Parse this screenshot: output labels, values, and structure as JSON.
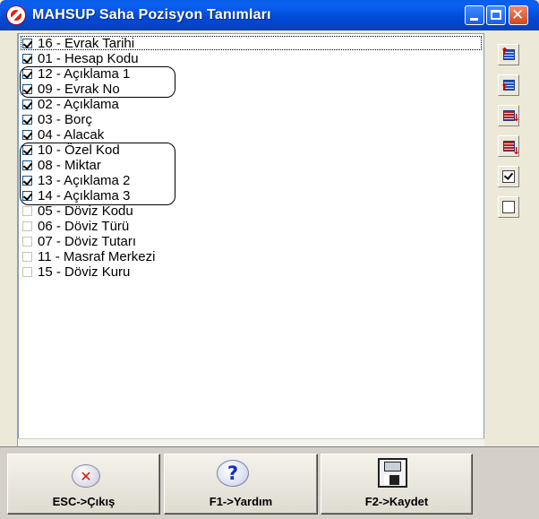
{
  "window": {
    "title": "MAHSUP Saha Pozisyon Tanımları"
  },
  "items": [
    {
      "label": "16 - Evrak Tarihi",
      "checked": true
    },
    {
      "label": "01 - Hesap Kodu",
      "checked": true
    },
    {
      "label": "12 - Açıklama 1",
      "checked": true
    },
    {
      "label": "09 - Evrak No",
      "checked": true
    },
    {
      "label": "02 - Açıklama",
      "checked": true
    },
    {
      "label": "03 - Borç",
      "checked": true
    },
    {
      "label": "04 - Alacak",
      "checked": true
    },
    {
      "label": "10 - Özel Kod",
      "checked": true
    },
    {
      "label": "08 - Miktar",
      "checked": true
    },
    {
      "label": "13 - Açıklama 2",
      "checked": true
    },
    {
      "label": "14 - Açıklama 3",
      "checked": true
    },
    {
      "label": "05 - Döviz Kodu",
      "checked": false
    },
    {
      "label": "06 - Döviz Türü",
      "checked": false
    },
    {
      "label": "07 - Döviz Tutarı",
      "checked": false
    },
    {
      "label": "11 - Masraf Merkezi",
      "checked": false
    },
    {
      "label": "15 - Döviz Kuru",
      "checked": false
    }
  ],
  "side_tools": [
    {
      "icon": "move-top-icon"
    },
    {
      "icon": "move-up-icon"
    },
    {
      "icon": "move-down-icon"
    },
    {
      "icon": "move-bottom-icon"
    },
    {
      "icon": "check-all-icon"
    },
    {
      "icon": "uncheck-all-icon"
    }
  ],
  "footer": {
    "esc_label": "ESC->Çıkış",
    "help_label": "F1->Yardım",
    "save_label": "F2->Kaydet"
  },
  "colors": {
    "titlebar": "#0054e3",
    "close_button": "#d2451e",
    "esc_icon": "#e01010",
    "help_icon": "#1030c0"
  }
}
